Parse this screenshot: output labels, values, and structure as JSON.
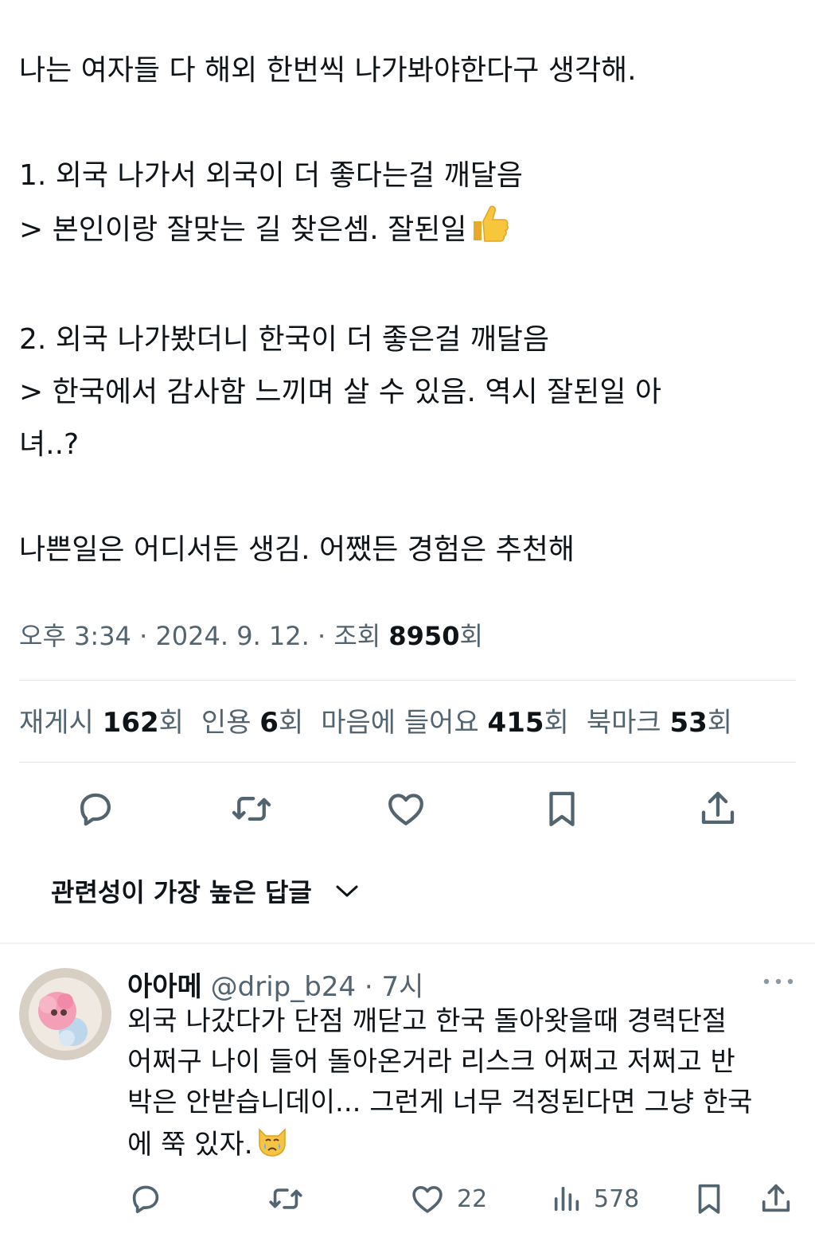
{
  "tweet": {
    "intro": "나는 여자들 다 해외 한번씩 나가봐야한다구 생각해.",
    "point1": "1. 외국 나가서 외국이 더 좋다는걸 깨달음",
    "point1_result": "> 본인이랑 잘맞는 길 찾은셈. 잘된일",
    "point1_emoji": "thumbs-up-icon",
    "point2": "2. 외국 나가봤더니 한국이 더 좋은걸 깨달음",
    "point2_result_1": "> 한국에서 감사함 느끼며 살 수 있음. 역시 잘된일 아",
    "point2_result_2": "녀..?",
    "closing": "나쁜일은 어디서든 생김. 어쨌든 경험은 추천해"
  },
  "meta": {
    "time": "오후 3:34",
    "sep1": " · ",
    "date": "2024. 9. 12.",
    "sep2": " · ",
    "views_label": "조회 ",
    "views_count": "8950",
    "views_unit": "회"
  },
  "stats": {
    "retweets_label": "재게시 ",
    "retweets_count": "162",
    "retweets_unit": "회",
    "quotes_label": "인용 ",
    "quotes_count": "6",
    "quotes_unit": "회",
    "likes_label": "마음에 들어요 ",
    "likes_count": "415",
    "likes_unit": "회",
    "bookmarks_label": "북마크 ",
    "bookmarks_count": "53",
    "bookmarks_unit": "회"
  },
  "actions": [
    "reply-icon",
    "retweet-icon",
    "like-icon",
    "bookmark-icon",
    "share-icon"
  ],
  "sort": {
    "label": "관련성이 가장 높은 답글",
    "icon": "chevron-down-icon"
  },
  "reply": {
    "name": "아아메",
    "handle": "@drip_b24",
    "sep": " · ",
    "time": "7시",
    "lines": [
      "외국 나갔다가 단점 깨닫고 한국 돌아왓을때 경력단절",
      "어쩌구 나이 들어 돌아온거라 리스크 어쩌고 저쩌고 반",
      "박은 안받습니데이... 그런게 너무 걱정된다면 그냥 한국",
      "에 쭉 있자."
    ],
    "emoji": "crying-cat-icon",
    "likes": "22",
    "views": "578"
  },
  "colors": {
    "text": "#0f1419",
    "secondary": "#536471",
    "divider": "#e1e6ea"
  }
}
